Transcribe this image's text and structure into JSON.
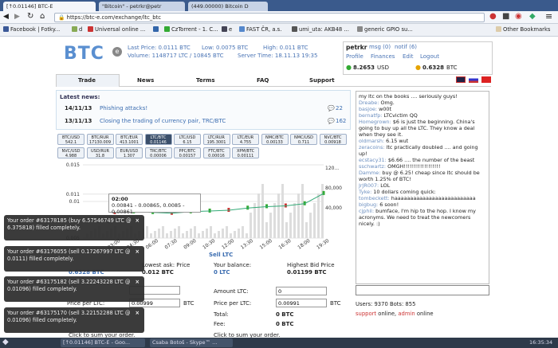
{
  "tabs": [
    {
      "label": "[↑0.01146] BTC-E"
    },
    {
      "label": "\"Bitcoin\" - petrkr@petr"
    },
    {
      "label": "(449.00000) Bitcoin D"
    }
  ],
  "address": {
    "url": "https://btc-e.com/exchange/ltc_btc"
  },
  "bookmarks": [
    {
      "label": "Facebook | Fotky..."
    },
    {
      "label": "d"
    },
    {
      "label": "Universal online ..."
    },
    {
      "label": ""
    },
    {
      "label": "CzTorrent - 1. C..."
    },
    {
      "label": "e"
    },
    {
      "label": "FAST ČR, a.s."
    },
    {
      "label": "umi_uta: AKB48 ..."
    },
    {
      "label": "generic GPIO su..."
    },
    {
      "label": "Other Bookmarks"
    }
  ],
  "header": {
    "logo": "BTC",
    "logo_e": "e",
    "last_price": "Last Price: 0.0111 BTC",
    "low": "Low: 0.0075 BTC",
    "high": "High: 0.011 BTC",
    "volume": "Volume: 1148717 LTC / 10845 BTC",
    "server_time": "Server Time: 18.11.13 19:35"
  },
  "user": {
    "name": "petrkr",
    "msg": "msg (0)",
    "notif": "notif (6)",
    "links": [
      "Profile",
      "Finances",
      "Edit",
      "Logout"
    ],
    "usd": "8.2653",
    "usd_unit": "USD",
    "btc": "0.6328",
    "btc_unit": "BTC"
  },
  "nav": [
    "Trade",
    "News",
    "Terms",
    "FAQ",
    "Support"
  ],
  "news": {
    "title": "Latest news:",
    "items": [
      {
        "date": "14/11/13",
        "text": "Phishing attacks!",
        "count": "22"
      },
      {
        "date": "13/11/13",
        "text": "Closing the trading of currency pair, TRC/BTC",
        "count": "162"
      }
    ]
  },
  "pairs": [
    {
      "name": "BTC/USD",
      "price": "542.1"
    },
    {
      "name": "BTC/RUR",
      "price": "17130.009"
    },
    {
      "name": "BTC/EUR",
      "price": "413.1001"
    },
    {
      "name": "LTC/BTC",
      "price": "0.01146"
    },
    {
      "name": "LTC/USD",
      "price": "6.15"
    },
    {
      "name": "LTC/RUR",
      "price": "195.3001"
    },
    {
      "name": "LTC/EUR",
      "price": "4.755"
    },
    {
      "name": "NMC/BTC",
      "price": "0.00133"
    },
    {
      "name": "NMC/USD",
      "price": "0.711"
    },
    {
      "name": "NVC/BTC",
      "price": "0.00918"
    },
    {
      "name": "NVC/USD",
      "price": "4.988"
    },
    {
      "name": "USD/RUR",
      "price": "31.8"
    },
    {
      "name": "EUR/USD",
      "price": "1.307"
    },
    {
      "name": "TRC/BTC",
      "price": "0.00006"
    },
    {
      "name": "PPC/BTC",
      "price": "0.00157"
    },
    {
      "name": "FTC/BTC",
      "price": "0.00016"
    },
    {
      "name": "XPM/BTC",
      "price": "0.00111"
    }
  ],
  "chart_data": {
    "type": "line",
    "title": "",
    "y_ticks": [
      "0.015",
      "0.011",
      "0.01",
      "0.005"
    ],
    "y2_ticks": [
      "120...",
      "80,000",
      "40,000"
    ],
    "x": [
      "03:00",
      "04:30",
      "06:00",
      "07:30",
      "09:00",
      "10:30",
      "12:00",
      "13:30",
      "15:00",
      "16:30",
      "18:00",
      "19:30"
    ],
    "series": [
      {
        "values": [
          0.0085,
          0.0086,
          0.0085,
          0.0084,
          0.0086,
          0.0087,
          0.0088,
          0.0091,
          0.0093,
          0.0094,
          0.0097,
          0.0111
        ]
      }
    ],
    "tooltip": {
      "time": "02:00",
      "values": "0.00841 - 0.00865, 0.0085 - 0.00861"
    }
  },
  "forms": {
    "lowest_ask_label": "Lowest ask: Price",
    "lowest_ask": "0.012 BTC",
    "balance_btc": "0.6328 BTC",
    "sell_title": "Sell LTC",
    "your_balance": "Your balance:",
    "balance_ltc": "0 LTC",
    "highest_bid_label": "Highest Bid Price",
    "highest_bid": "0.01199 BTC",
    "amount_label": "Amount LTC:",
    "amount_value": "0",
    "price_label": "Price per LTC:",
    "price_value": "0.00991",
    "price_unit": "BTC",
    "buy_price_label": "Price per LTC:",
    "buy_price_value": "0.00999",
    "buy_price_unit": "BTC",
    "total_label": "Total:",
    "total_value": "0 BTC",
    "fee_label": "Fee:",
    "fee_value": "0 BTC",
    "sum_order": "Click to sum your order."
  },
  "toasts": [
    {
      "text": "Your order #63178185 (buy 6.57546749 LTC @ 6.375818) filled completely."
    },
    {
      "text": "Your order #63176055 (sell 0.17267997 LTC @ 0.0111) filled completely."
    },
    {
      "text": "Your order #63175182 (sell 3.22243228 LTC @ 0.01096) filled completely."
    },
    {
      "text": "Your order #63175170 (sell 3.22152288 LTC @ 0.01096) filled completely."
    }
  ],
  "chat": [
    {
      "user": "",
      "text": "my ltc on the books .... seriously guys!"
    },
    {
      "user": "Dreabe:",
      "text": "Omg."
    },
    {
      "user": "basjoe:",
      "text": "w00t"
    },
    {
      "user": "bernatfp:",
      "text": "LTCvictim QQ"
    },
    {
      "user": "Homegrown:",
      "text": "$6 is just the beginning. China's going to buy up all the LTC. They know a deal when they see it."
    },
    {
      "user": "oldmarsh:",
      "text": "6.15 wut"
    },
    {
      "user": "zeracoins:",
      "text": "ltc practically doubled .... and going up!"
    },
    {
      "user": "ecstacy31:",
      "text": "$6.66 .... the number of the beast"
    },
    {
      "user": "sschwartz:",
      "text": "OMGH!!!!!!!!!!!!!!!!!!"
    },
    {
      "user": "Damme:",
      "text": "buy @ 6.25! cheap since ltc should be worth 1.25% of BTC!"
    },
    {
      "user": "JrJR007:",
      "text": "LOL"
    },
    {
      "user": "Tyke:",
      "text": "10 dollars coming quick:"
    },
    {
      "user": "tombeckett:",
      "text": "haaaaaaaaaaaaaaaaaaaaaaaaaa"
    },
    {
      "user": "bigbug:",
      "text": "6 soon!"
    },
    {
      "user": "cjphil:",
      "text": "bumface, I'm hip to the hop. I know my acronyms. We need to treat the newcomers nicely. :)"
    }
  ],
  "users": {
    "count": "Users: 9370 Bots: 855",
    "support": "support",
    "online": "online,",
    "admin": "admin",
    "online2": "online"
  },
  "taskbar": {
    "items": [
      "[↑0.01146] BTC-E - Goo...",
      "Csaba Botoš - Skype™ ..."
    ],
    "clock": "16:35:34"
  }
}
